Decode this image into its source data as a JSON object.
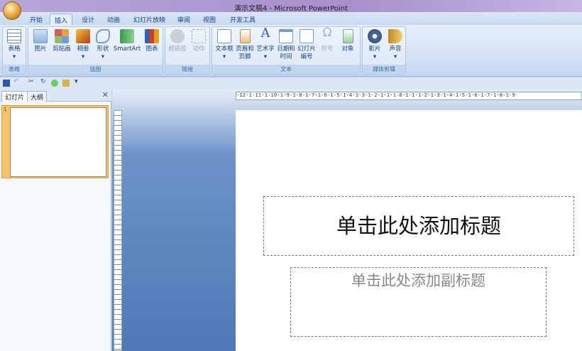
{
  "window": {
    "title": "演示文稿4 - Microsoft PowerPoint"
  },
  "tabs": [
    "开始",
    "插入",
    "设计",
    "动画",
    "幻灯片放映",
    "审阅",
    "视图",
    "开发工具"
  ],
  "active_tab": "插入",
  "ribbon": {
    "groups": [
      {
        "label": "表格",
        "buttons": [
          {
            "label": "表格",
            "icon": "table-icon"
          }
        ]
      },
      {
        "label": "插图",
        "buttons": [
          {
            "label": "图片",
            "icon": "picture-icon"
          },
          {
            "label": "剪贴画",
            "icon": "clipart-icon"
          },
          {
            "label": "相册",
            "icon": "photo-album-icon"
          },
          {
            "label": "形状",
            "icon": "shapes-icon"
          },
          {
            "label": "SmartArt",
            "icon": "smartart-icon"
          },
          {
            "label": "图表",
            "icon": "chart-icon"
          }
        ]
      },
      {
        "label": "链接",
        "buttons": [
          {
            "label": "超链接",
            "icon": "hyperlink-icon",
            "disabled": true
          },
          {
            "label": "动作",
            "icon": "action-icon",
            "disabled": true
          }
        ]
      },
      {
        "label": "文本",
        "buttons": [
          {
            "label": "文本框",
            "icon": "textbox-icon"
          },
          {
            "label": "页眉和页脚",
            "icon": "header-footer-icon"
          },
          {
            "label": "艺术字",
            "icon": "wordart-icon"
          },
          {
            "label": "日期和时间",
            "icon": "date-time-icon"
          },
          {
            "label": "幻灯片编号",
            "icon": "slide-number-icon"
          },
          {
            "label": "符号",
            "icon": "symbol-icon",
            "disabled": true
          },
          {
            "label": "对象",
            "icon": "object-icon"
          }
        ]
      },
      {
        "label": "媒体剪辑",
        "buttons": [
          {
            "label": "影片",
            "icon": "movie-icon"
          },
          {
            "label": "声音",
            "icon": "sound-icon"
          }
        ]
      }
    ]
  },
  "panel": {
    "tabs": [
      "幻灯片",
      "大纲"
    ],
    "slide_number": "1"
  },
  "ruler": "·12·1·11·1·10·1·9·1·8·1·7·1·6·1·5·1·4·1·3·1·2·1·1·1·0·1·1·1·2·1·3·1·4·1·5·1·6·1·7·1·8·1·9·",
  "slide": {
    "title_placeholder": "单击此处添加标题",
    "subtitle_placeholder": "单击此处添加副标题"
  }
}
